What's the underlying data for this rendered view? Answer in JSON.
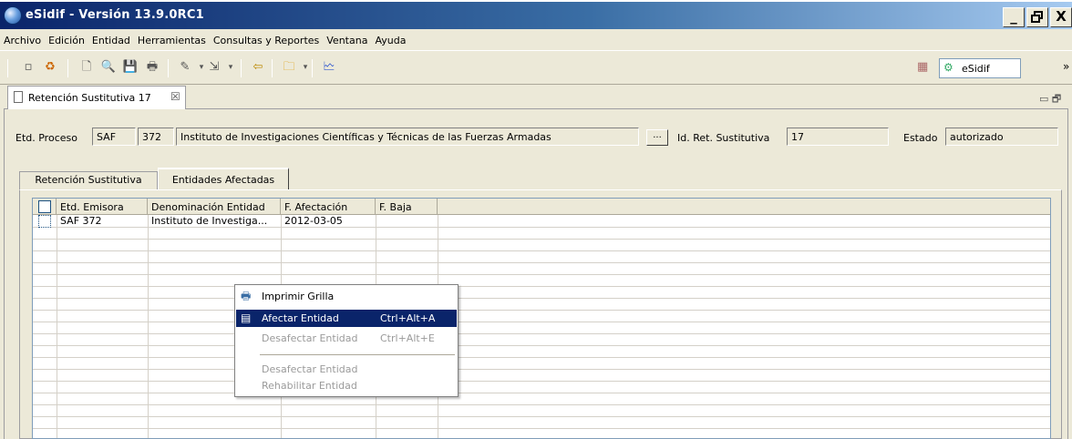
{
  "window": {
    "title": "eSidif - Versión 13.9.0RC1",
    "minimize": "_",
    "maximize": "🗗",
    "close": "X"
  },
  "menu": [
    "Archivo",
    "Edición",
    "Entidad",
    "Herramientas",
    "Consultas y Reportes",
    "Ventana",
    "Ayuda"
  ],
  "toolbar": {
    "perspective_label": "eSidif",
    "overflow": "»"
  },
  "editor_tab": {
    "label": "Retención Sustitutiva 17",
    "close": "☒"
  },
  "header": {
    "proceso_label": "Etd. Proceso",
    "proceso_code": "SAF",
    "proceso_num": "372",
    "proceso_name": "Instituto de Investigaciones Científicas y Técnicas de las Fuerzas Armadas",
    "dots": "...",
    "id_ret_label": "Id. Ret. Sustitutiva",
    "id_ret_value": "17",
    "estado_label": "Estado",
    "estado_value": "autorizado"
  },
  "tabs": {
    "tab1": "Retención Sustitutiva",
    "tab2": "Entidades Afectadas"
  },
  "table": {
    "columns": [
      "Etd. Emisora",
      "Denominación Entidad",
      "F. Afectación",
      "F. Baja"
    ],
    "rows": [
      [
        "SAF 372",
        "Instituto de Investiga...",
        "2012-03-05",
        ""
      ]
    ]
  },
  "context_menu": {
    "items": [
      {
        "label": "Imprimir Grilla",
        "shortcut": ""
      },
      {
        "label": "Afectar Entidad",
        "shortcut": "Ctrl+Alt+A"
      },
      {
        "label": "Desafectar Entidad",
        "shortcut": "Ctrl+Alt+E"
      },
      {
        "label": "Desafectar Entidad",
        "shortcut": ""
      },
      {
        "label": "Rehabilitar Entidad",
        "shortcut": ""
      }
    ]
  }
}
